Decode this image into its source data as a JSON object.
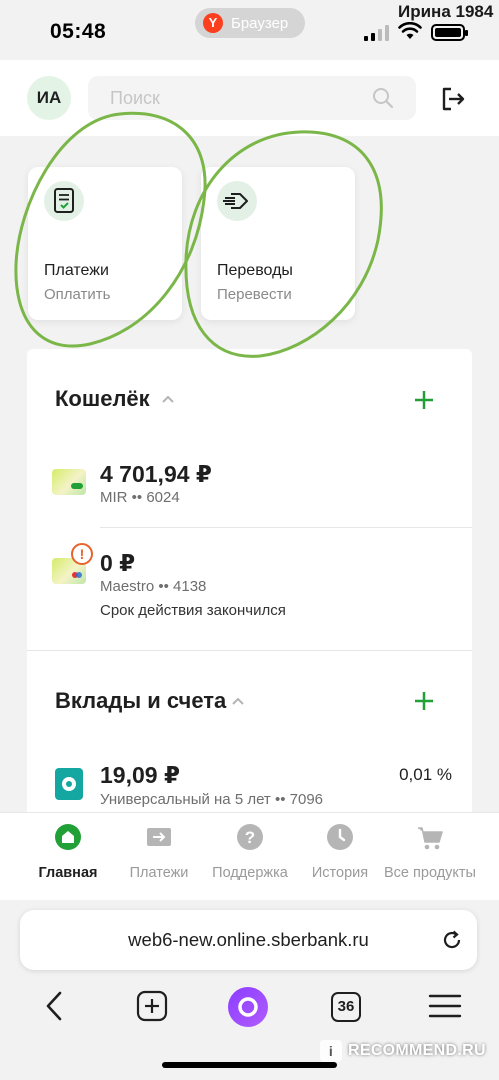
{
  "status_bar": {
    "time": "05:48",
    "browser_label": "Браузер",
    "browser_logo": "Y",
    "watermark_name": "Ирина 1984"
  },
  "header": {
    "avatar_initials": "ИА",
    "search_placeholder": "Поиск"
  },
  "quick_actions": [
    {
      "title": "Платежи",
      "subtitle": "Оплатить",
      "icon": "payments-doc-icon"
    },
    {
      "title": "Переводы",
      "subtitle": "Перевести",
      "icon": "transfer-arrow-icon"
    }
  ],
  "wallet": {
    "title": "Кошелёк",
    "cards": [
      {
        "amount": "4 701,94 ₽",
        "info": "MIR •• 6024",
        "note": ""
      },
      {
        "amount": "0 ₽",
        "info": "Maestro •• 4138",
        "note": "Срок действия закончился",
        "warning": "!"
      }
    ]
  },
  "deposits": {
    "title": "Вклады и счета",
    "accounts": [
      {
        "amount": "19,09 ₽",
        "info": "Универсальный на 5 лет •• 7096",
        "rate": "0,01 %"
      }
    ]
  },
  "tabs": [
    {
      "label": "Главная",
      "active": true
    },
    {
      "label": "Платежи",
      "active": false
    },
    {
      "label": "Поддержка",
      "active": false
    },
    {
      "label": "История",
      "active": false
    },
    {
      "label": "Все продукты",
      "active": false
    }
  ],
  "browser": {
    "url": "web6-new.online.sberbank.ru",
    "tabs_count": "36"
  },
  "watermark": {
    "site": "RECOMMEND.RU",
    "icon_letter": "i"
  },
  "colors": {
    "accent_green": "#21a038",
    "annotation_green": "#7ab648",
    "warning_orange": "#e8632b",
    "alice_purple": "#8b3dff"
  }
}
